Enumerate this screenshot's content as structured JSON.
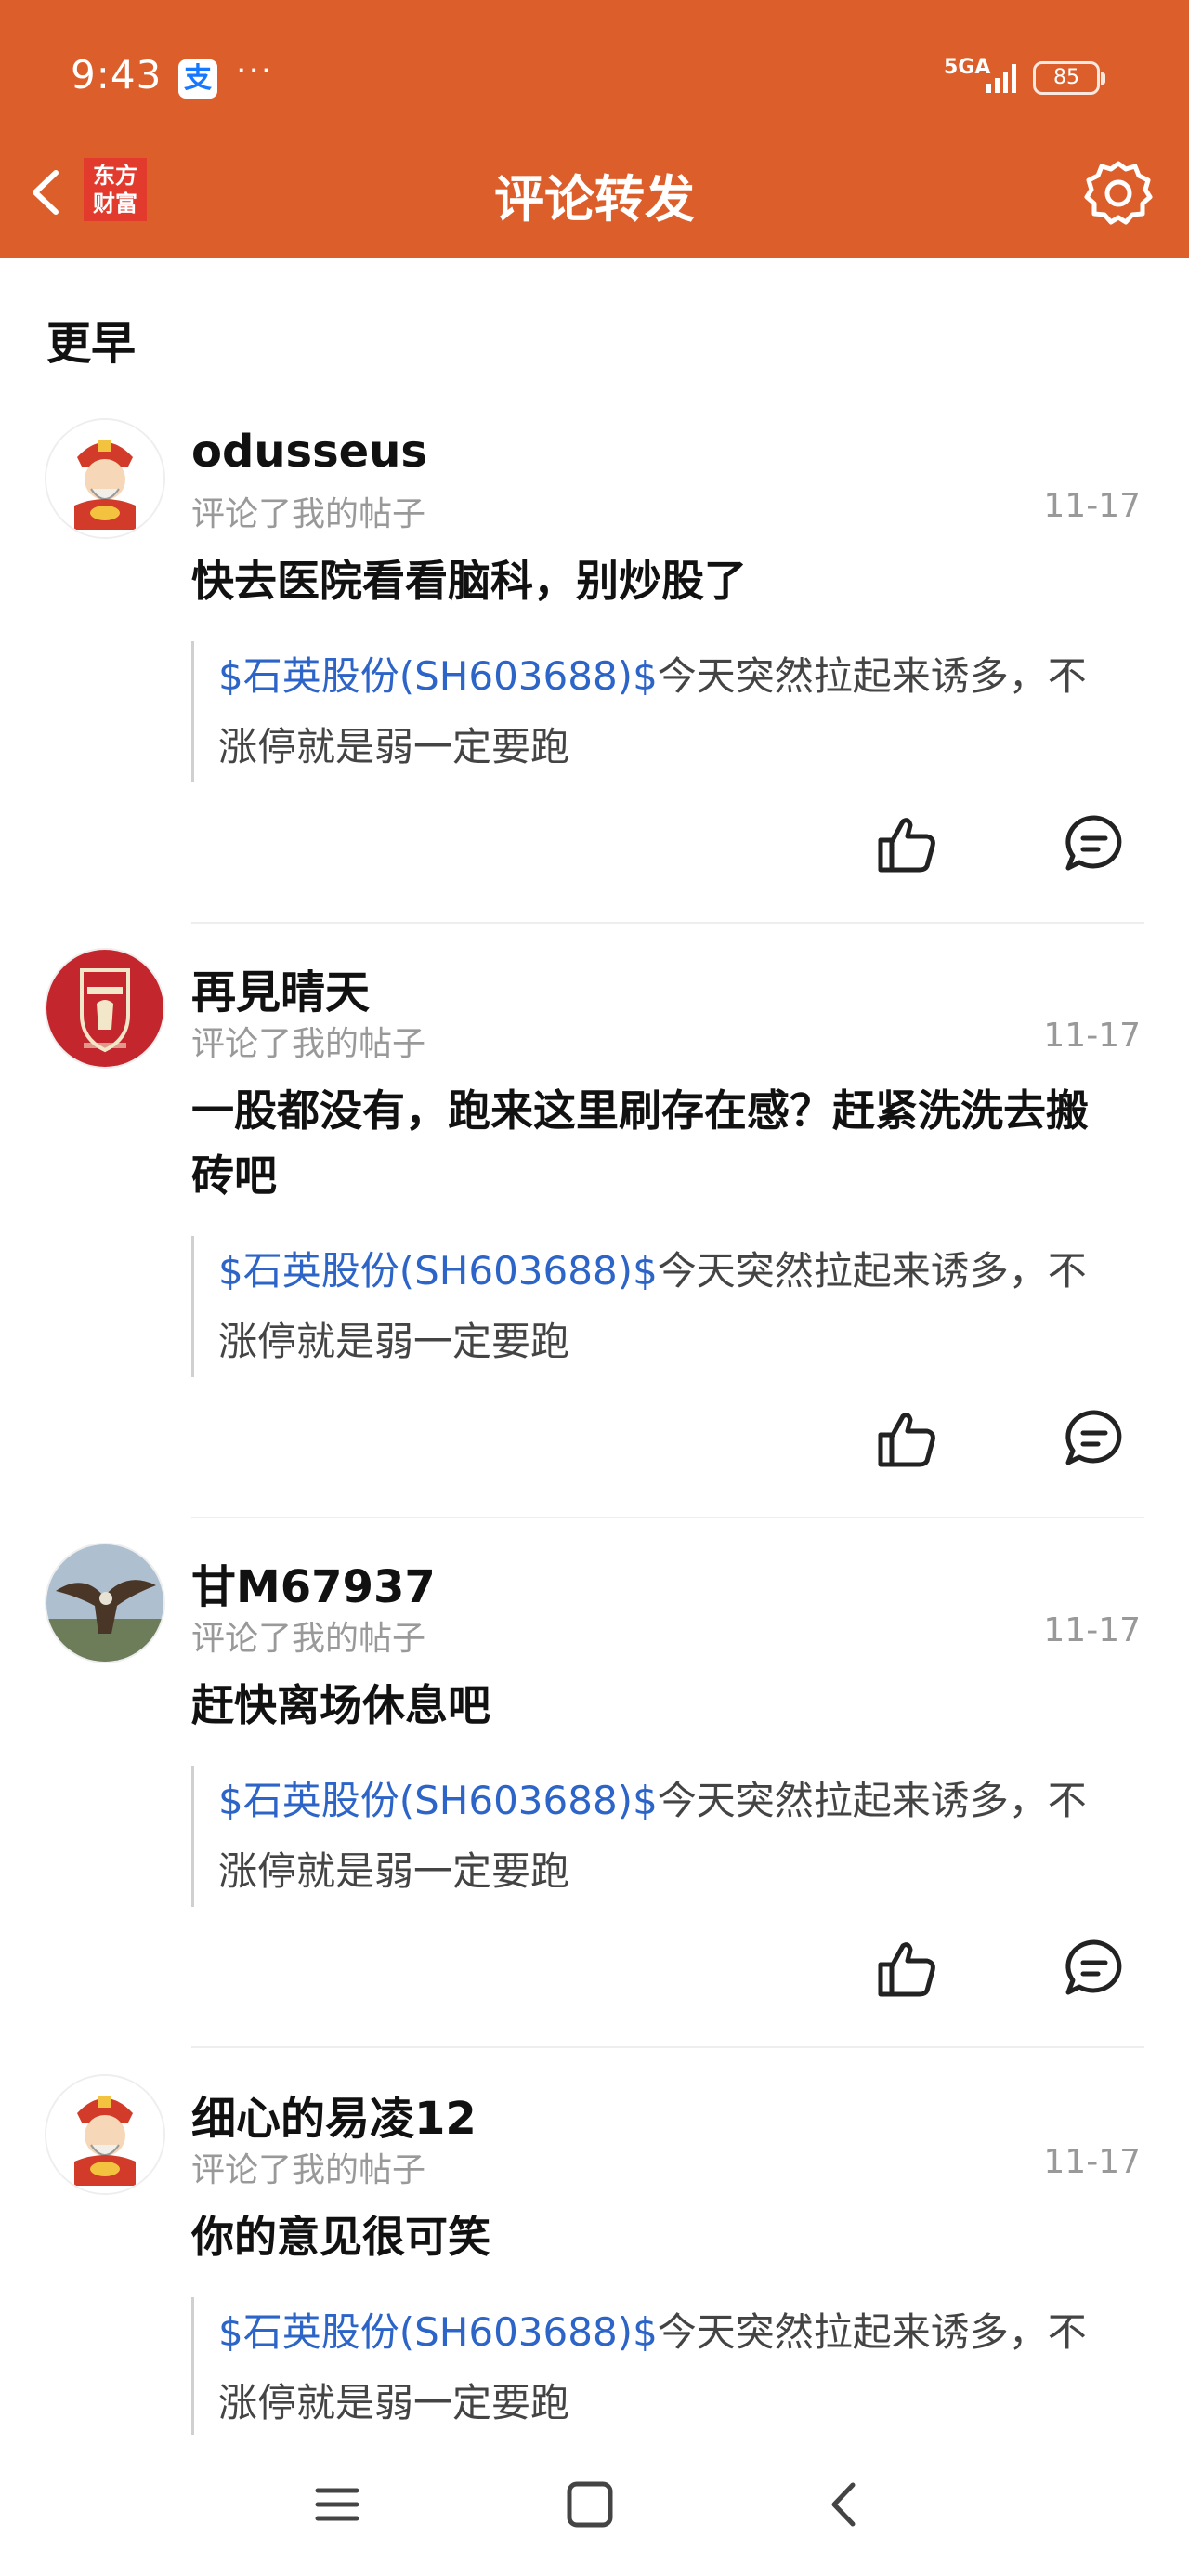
{
  "status_bar": {
    "time": "9:43",
    "app_icon": "支",
    "dots": "···",
    "network": "5GA",
    "battery": "85"
  },
  "nav": {
    "brand_logo_line1": "东方",
    "brand_logo_line2": "财富",
    "title": "评论转发"
  },
  "section_title": "更早",
  "comments": [
    {
      "username": "odusseus",
      "action": "评论了我的帖子",
      "time": "11-17",
      "text": "快去医院看看脑科，别炒股了",
      "quote_link": "$石英股份(SH603688)$",
      "quote_text": "今天突然拉起来诱多，不涨停就是弱一定要跑",
      "avatar": "caishen-avatar"
    },
    {
      "username": "再見晴天",
      "action": "评论了我的帖子",
      "time": "11-17",
      "text": "一股都没有，跑来这里刷存在感？赶紧洗洗去搬砖吧",
      "quote_link": "$石英股份(SH603688)$",
      "quote_text": "今天突然拉起来诱多，不涨停就是弱一定要跑",
      "avatar": "liverpool-avatar"
    },
    {
      "username": "甘M67937",
      "action": "评论了我的帖子",
      "time": "11-17",
      "text": "赶快离场休息吧",
      "quote_link": "$石英股份(SH603688)$",
      "quote_text": "今天突然拉起来诱多，不涨停就是弱一定要跑",
      "avatar": "eagle-avatar"
    },
    {
      "username": "细心的易凌12",
      "action": "评论了我的帖子",
      "time": "11-17",
      "text": "你的意见很可笑",
      "quote_link": "$石英股份(SH603688)$",
      "quote_text": "今天突然拉起来诱多，不涨停就是弱一定要跑",
      "avatar": "caishen-avatar"
    }
  ],
  "colors": {
    "header_bg": "#dc5f2b",
    "link": "#2c64c8",
    "muted": "#999999"
  },
  "icons": [
    "back-arrow-icon",
    "gear-icon",
    "thumbs-up-icon",
    "comment-bubble-icon",
    "menu-icon",
    "home-square-icon",
    "system-back-icon"
  ]
}
